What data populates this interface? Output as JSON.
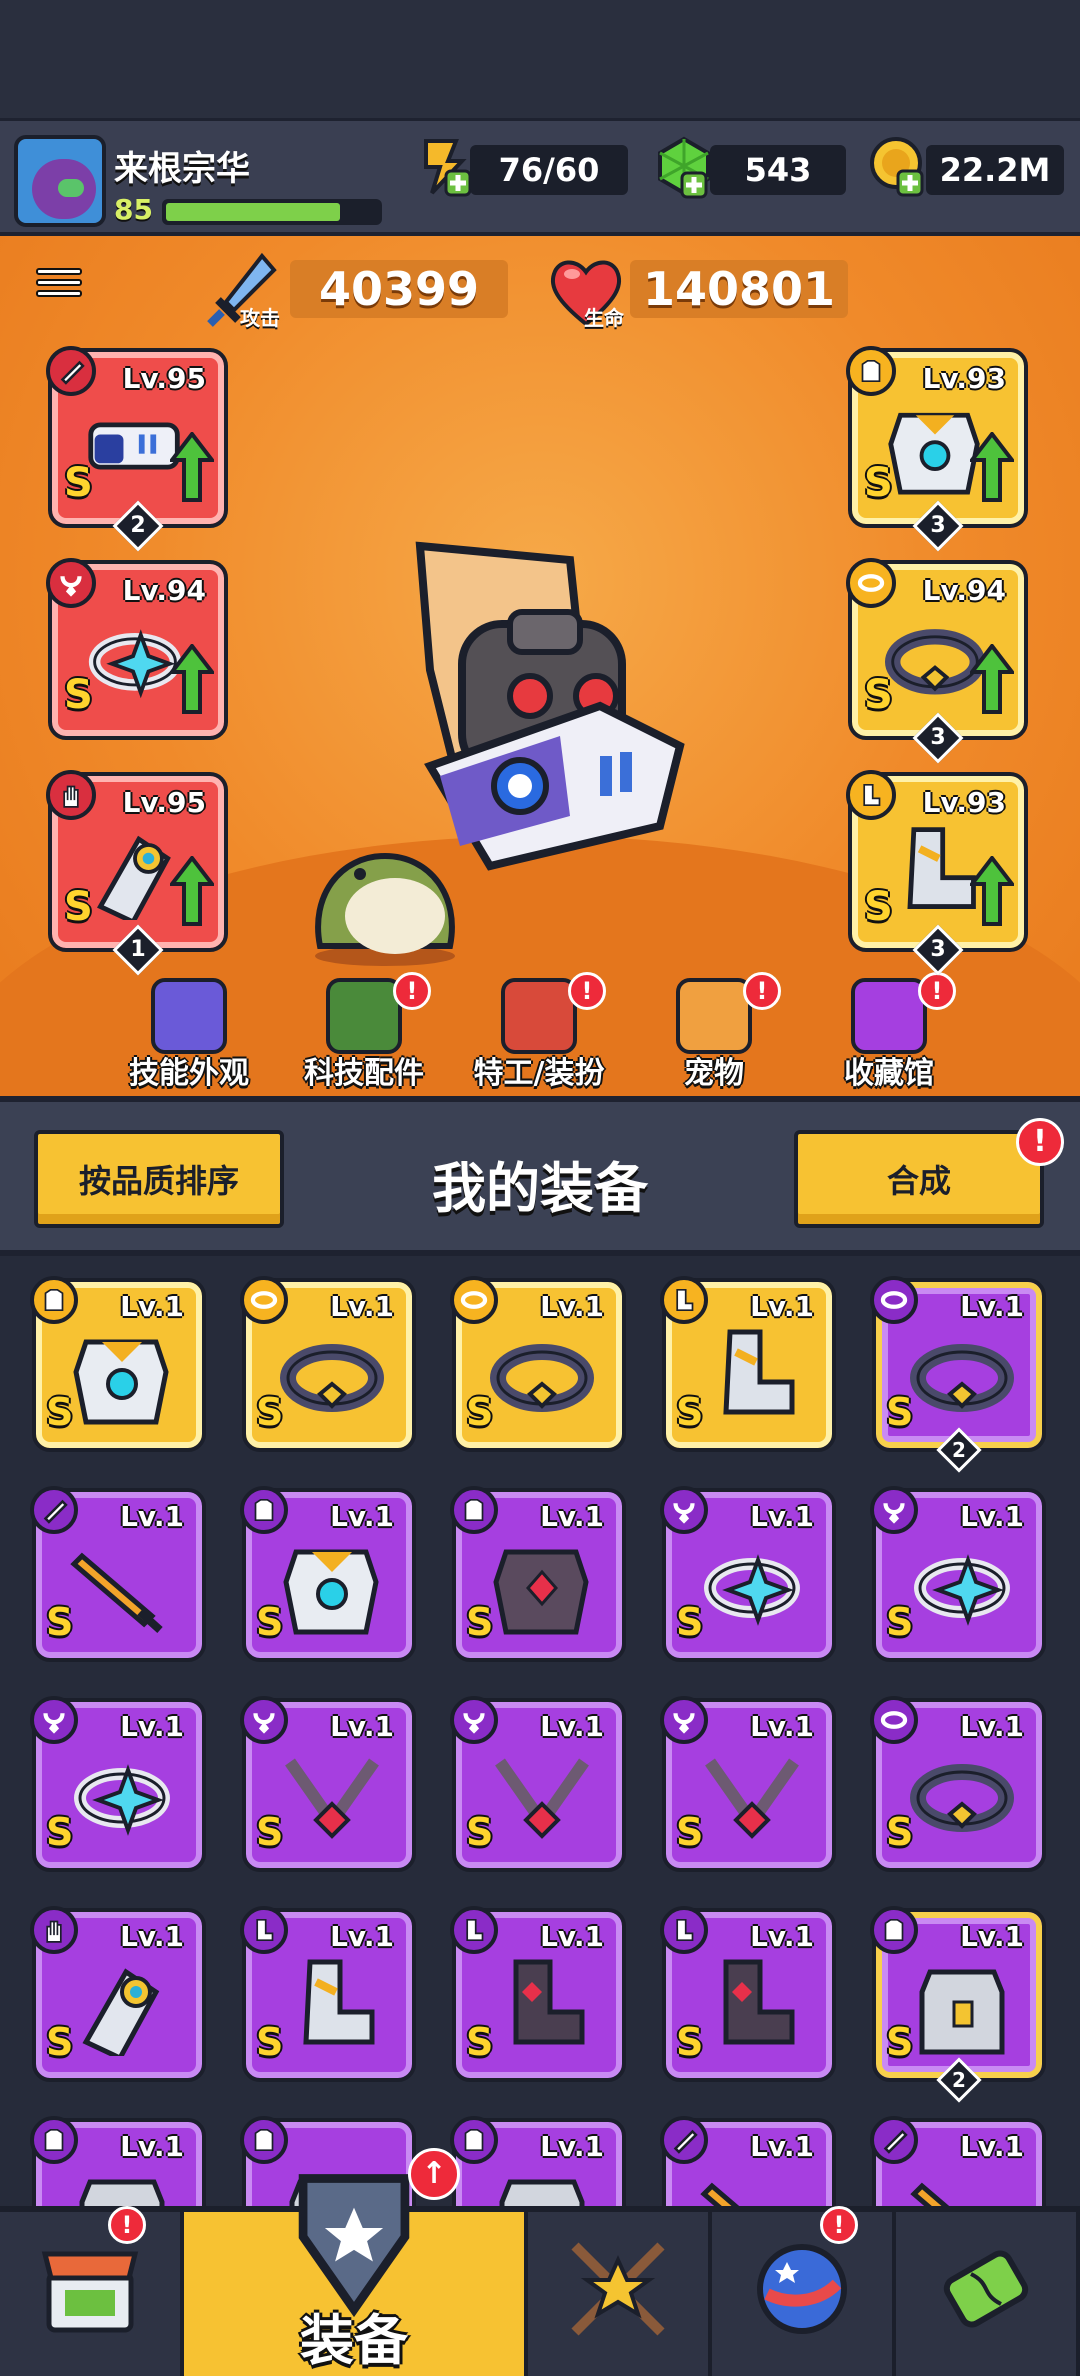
{
  "player": {
    "name": "来根宗华",
    "level": "85",
    "xp_fraction": 0.82
  },
  "resources": {
    "energy": "76/60",
    "gems": "543",
    "coins": "22.2M"
  },
  "stats": {
    "attack_label": "攻击",
    "attack_value": "40399",
    "hp_label": "生命",
    "hp_value": "140801"
  },
  "equipped": {
    "left": [
      {
        "slot_icon": "knife-icon",
        "item_icon": "gun-icon",
        "level": "Lv.95",
        "grade": "S",
        "count": "2",
        "rarity": "red",
        "upgrade": true
      },
      {
        "slot_icon": "necklace-icon",
        "item_icon": "ring-icon",
        "level": "Lv.94",
        "grade": "S",
        "count": "",
        "rarity": "red",
        "upgrade": true
      },
      {
        "slot_icon": "glove-icon",
        "item_icon": "gauntlet-icon",
        "level": "Lv.95",
        "grade": "S",
        "count": "1",
        "rarity": "red",
        "upgrade": true
      }
    ],
    "right": [
      {
        "slot_icon": "armor-icon",
        "item_icon": "chest-armor-icon",
        "level": "Lv.93",
        "grade": "S",
        "count": "3",
        "rarity": "yellow",
        "upgrade": true
      },
      {
        "slot_icon": "belt-icon",
        "item_icon": "belt-icon",
        "level": "Lv.94",
        "grade": "S",
        "count": "3",
        "rarity": "yellow",
        "upgrade": true
      },
      {
        "slot_icon": "boot-icon",
        "item_icon": "boot-icon",
        "level": "Lv.93",
        "grade": "S",
        "count": "3",
        "rarity": "yellow",
        "upgrade": true
      }
    ]
  },
  "hero_nav": [
    {
      "label": "技能外观",
      "icon": "skill-skin-icon",
      "alert": false
    },
    {
      "label": "科技配件",
      "icon": "tech-parts-icon",
      "alert": true
    },
    {
      "label": "特工/装扮",
      "icon": "agent-costume-icon",
      "alert": true
    },
    {
      "label": "宠物",
      "icon": "pet-icon",
      "alert": true
    },
    {
      "label": "收藏馆",
      "icon": "collection-icon",
      "alert": true
    }
  ],
  "inventory": {
    "sort_label": "按品质排序",
    "title": "我的装备",
    "merge_label": "合成",
    "merge_alert": "!",
    "items": [
      {
        "slot": "armor-icon",
        "art": "chest-armor-icon",
        "level": "Lv.1",
        "grade": "S",
        "rarity": "yellow",
        "count": ""
      },
      {
        "slot": "belt-icon",
        "art": "belt-icon",
        "level": "Lv.1",
        "grade": "S",
        "rarity": "yellow",
        "count": ""
      },
      {
        "slot": "belt-icon",
        "art": "belt-icon",
        "level": "Lv.1",
        "grade": "S",
        "rarity": "yellow",
        "count": ""
      },
      {
        "slot": "boot-icon",
        "art": "boot-icon",
        "level": "Lv.1",
        "grade": "S",
        "rarity": "yellow",
        "count": ""
      },
      {
        "slot": "belt-icon",
        "art": "belt-icon",
        "level": "Lv.1",
        "grade": "S",
        "rarity": "elite",
        "count": "2"
      },
      {
        "slot": "knife-icon",
        "art": "sword-icon",
        "level": "Lv.1",
        "grade": "S",
        "rarity": "purple",
        "count": ""
      },
      {
        "slot": "armor-icon",
        "art": "chest-armor-icon",
        "level": "Lv.1",
        "grade": "S",
        "rarity": "purple",
        "count": ""
      },
      {
        "slot": "armor-icon",
        "art": "dark-armor-icon",
        "level": "Lv.1",
        "grade": "S",
        "rarity": "purple",
        "count": ""
      },
      {
        "slot": "necklace-icon",
        "art": "ring-icon",
        "level": "Lv.1",
        "grade": "S",
        "rarity": "purple",
        "count": ""
      },
      {
        "slot": "necklace-icon",
        "art": "ring-icon",
        "level": "Lv.1",
        "grade": "S",
        "rarity": "purple",
        "count": ""
      },
      {
        "slot": "necklace-icon",
        "art": "ring-icon",
        "level": "Lv.1",
        "grade": "S",
        "rarity": "purple",
        "count": ""
      },
      {
        "slot": "necklace-icon",
        "art": "chain-icon",
        "level": "Lv.1",
        "grade": "S",
        "rarity": "purple",
        "count": ""
      },
      {
        "slot": "necklace-icon",
        "art": "chain-icon",
        "level": "Lv.1",
        "grade": "S",
        "rarity": "purple",
        "count": ""
      },
      {
        "slot": "necklace-icon",
        "art": "chain-icon",
        "level": "Lv.1",
        "grade": "S",
        "rarity": "purple",
        "count": ""
      },
      {
        "slot": "belt-icon",
        "art": "belt-icon",
        "level": "Lv.1",
        "grade": "S",
        "rarity": "purple",
        "count": ""
      },
      {
        "slot": "glove-icon",
        "art": "gauntlet-icon",
        "level": "Lv.1",
        "grade": "S",
        "rarity": "purple",
        "count": ""
      },
      {
        "slot": "boot-icon",
        "art": "boot-icon",
        "level": "Lv.1",
        "grade": "S",
        "rarity": "purple",
        "count": ""
      },
      {
        "slot": "boot-icon",
        "art": "dark-boot-icon",
        "level": "Lv.1",
        "grade": "S",
        "rarity": "purple",
        "count": ""
      },
      {
        "slot": "boot-icon",
        "art": "dark-boot-icon",
        "level": "Lv.1",
        "grade": "S",
        "rarity": "purple",
        "count": ""
      },
      {
        "slot": "armor-icon",
        "art": "vest-icon",
        "level": "Lv.1",
        "grade": "S",
        "rarity": "elite",
        "count": "2"
      },
      {
        "slot": "armor-icon",
        "art": "vest-icon",
        "level": "Lv.1",
        "grade": "S",
        "rarity": "purple",
        "count": ""
      },
      {
        "slot": "armor-icon",
        "art": "vest-icon",
        "level": "",
        "grade": "S",
        "rarity": "purple",
        "count": ""
      },
      {
        "slot": "armor-icon",
        "art": "vest-icon",
        "level": "Lv.1",
        "grade": "S",
        "rarity": "purple",
        "count": ""
      },
      {
        "slot": "knife-icon",
        "art": "sword-icon",
        "level": "Lv.1",
        "grade": "S",
        "rarity": "purple",
        "count": ""
      },
      {
        "slot": "knife-icon",
        "art": "sword-icon",
        "level": "Lv.1",
        "grade": "S",
        "rarity": "purple",
        "count": ""
      }
    ]
  },
  "bottom_nav": [
    {
      "icon": "shop-icon",
      "label": "",
      "alert": true,
      "active": false
    },
    {
      "icon": "equipment-icon",
      "label": "装备",
      "alert": true,
      "active": true
    },
    {
      "icon": "battle-icon",
      "label": "",
      "alert": false,
      "active": false
    },
    {
      "icon": "planet-icon",
      "label": "",
      "alert": true,
      "active": false
    },
    {
      "icon": "dna-icon",
      "label": "",
      "alert": false,
      "active": false
    }
  ]
}
